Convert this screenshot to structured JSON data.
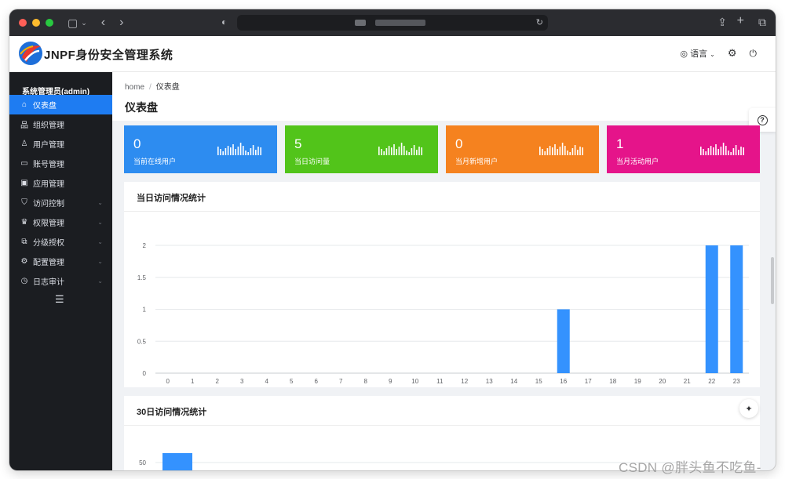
{
  "header": {
    "brand": "JNPF身份安全管理系统",
    "language_label": "语言",
    "colors": {
      "accent": "#1e7cf2"
    }
  },
  "sidebar": {
    "user_label": "系统管理员(admin)",
    "items": [
      {
        "label": "仪表盘",
        "icon": "home-icon",
        "active": true,
        "has_children": false
      },
      {
        "label": "组织管理",
        "icon": "org-icon",
        "active": false,
        "has_children": false
      },
      {
        "label": "用户管理",
        "icon": "user-icon",
        "active": false,
        "has_children": false
      },
      {
        "label": "账号管理",
        "icon": "id-card-icon",
        "active": false,
        "has_children": false
      },
      {
        "label": "应用管理",
        "icon": "app-icon",
        "active": false,
        "has_children": false
      },
      {
        "label": "访问控制",
        "icon": "shield-icon",
        "active": false,
        "has_children": true
      },
      {
        "label": "权限管理",
        "icon": "permission-icon",
        "active": false,
        "has_children": true
      },
      {
        "label": "分级授权",
        "icon": "copy-icon",
        "active": false,
        "has_children": true
      },
      {
        "label": "配置管理",
        "icon": "gear-icon",
        "active": false,
        "has_children": true
      },
      {
        "label": "日志审计",
        "icon": "clock-icon",
        "active": false,
        "has_children": true
      }
    ]
  },
  "breadcrumb": {
    "home": "home",
    "separator": "/",
    "current": "仪表盘"
  },
  "page_title": "仪表盘",
  "cards": [
    {
      "value": "0",
      "label": "当前在线用户",
      "color": "#2d8cf0"
    },
    {
      "value": "5",
      "label": "当日访问量",
      "color": "#52c41a"
    },
    {
      "value": "0",
      "label": "当月新增用户",
      "color": "#f5821f"
    },
    {
      "value": "1",
      "label": "当月活动用户",
      "color": "#e5148a"
    }
  ],
  "panels": {
    "daily_title": "当日访问情况统计",
    "monthly_title": "30日访问情况统计"
  },
  "chart_data": [
    {
      "type": "bar",
      "title": "当日访问情况统计",
      "categories": [
        "0",
        "1",
        "2",
        "3",
        "4",
        "5",
        "6",
        "7",
        "8",
        "9",
        "10",
        "11",
        "12",
        "13",
        "14",
        "15",
        "16",
        "17",
        "18",
        "19",
        "20",
        "21",
        "22",
        "23"
      ],
      "values": [
        0,
        0,
        0,
        0,
        0,
        0,
        0,
        0,
        0,
        0,
        0,
        0,
        0,
        0,
        0,
        0,
        1,
        0,
        0,
        0,
        0,
        0,
        2,
        2
      ],
      "yticks": [
        "0",
        "0.5",
        "1",
        "1.5",
        "2"
      ],
      "ylim": [
        0,
        2
      ],
      "grid": true,
      "color": "#3492fe"
    },
    {
      "type": "bar",
      "title": "30日访问情况统计",
      "yticks_visible": [
        "50"
      ],
      "values_visible": [
        58
      ],
      "ylim": [
        0,
        70
      ],
      "grid": true,
      "color": "#3492fe"
    }
  ],
  "watermark": "CSDN @胖头鱼不吃鱼-"
}
